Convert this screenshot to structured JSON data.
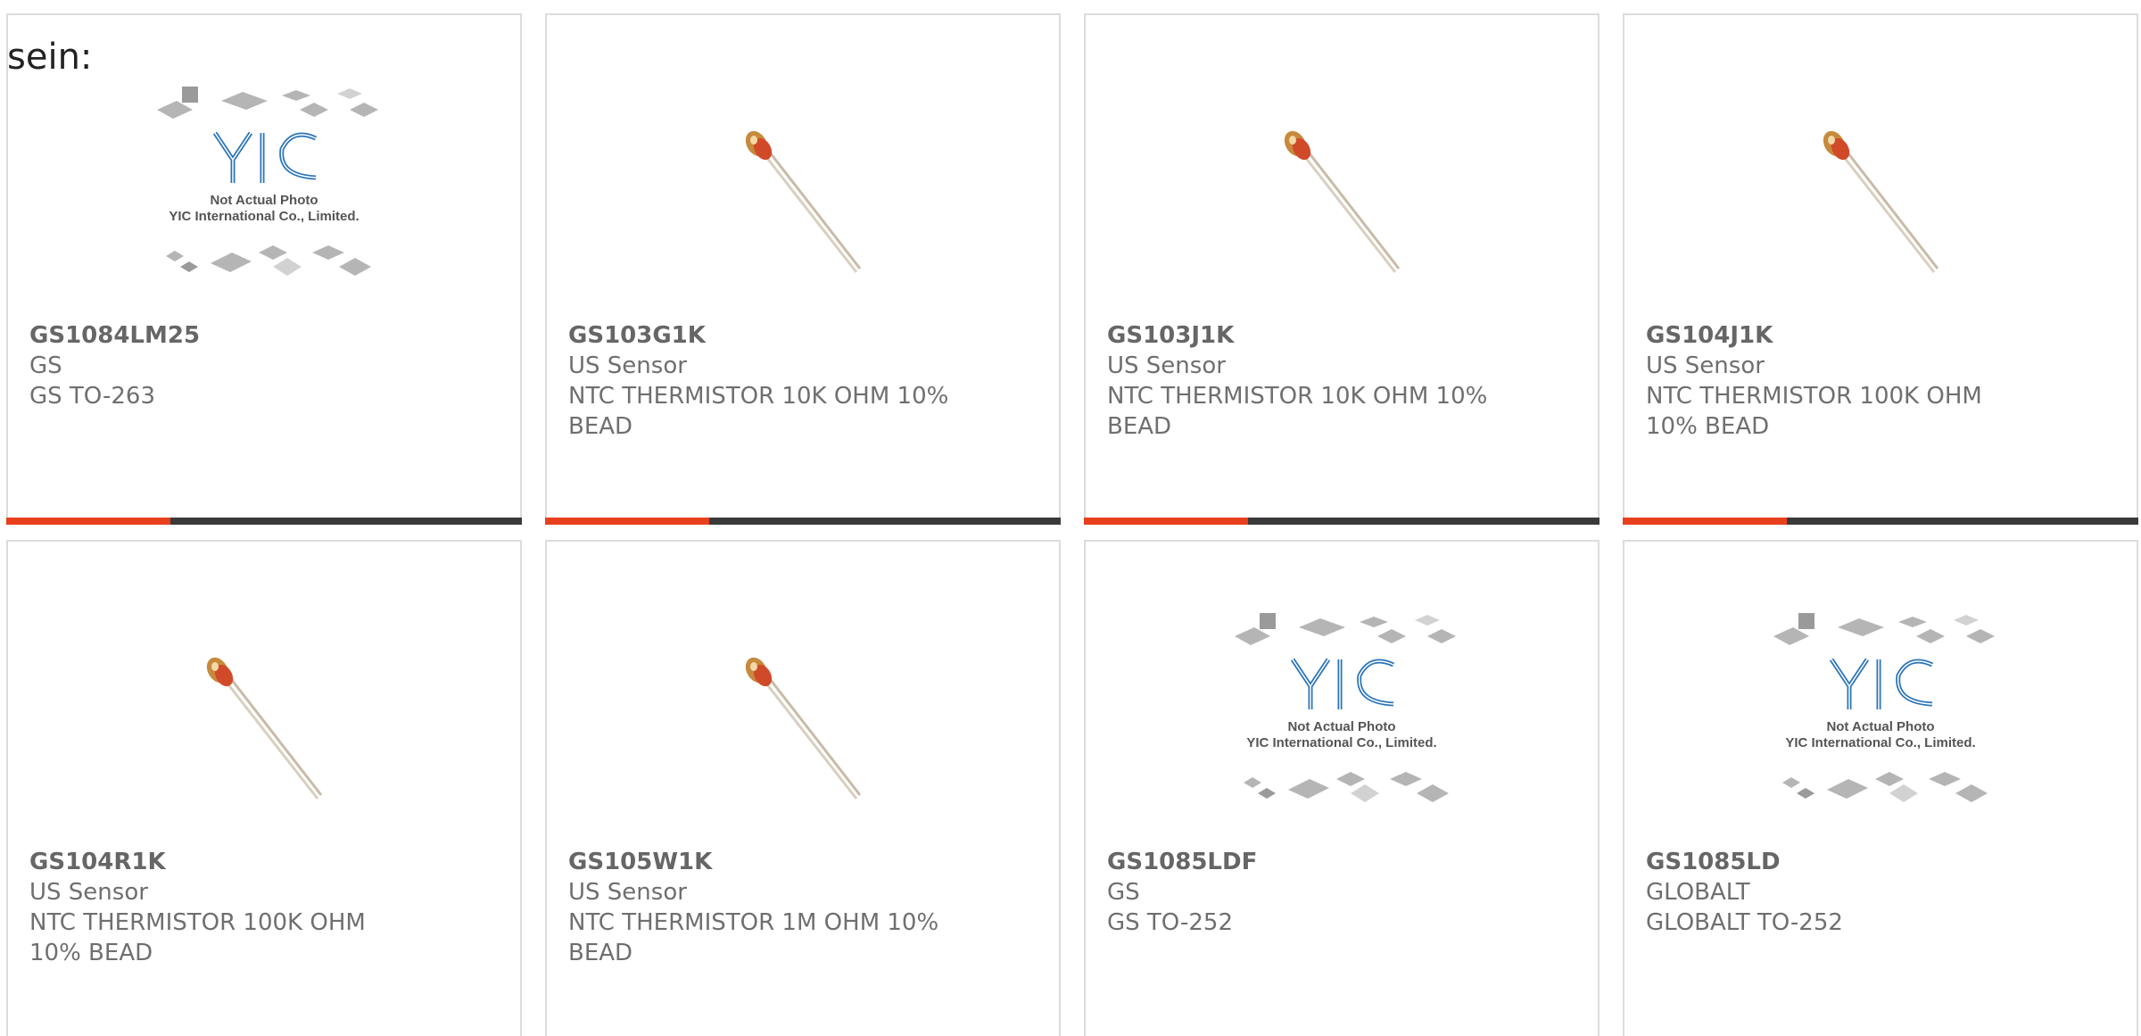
{
  "intro_text": "sein:",
  "placeholder_caption_line1": "Not Actual Photo",
  "placeholder_caption_line2": "YIC International Co., Limited.",
  "brand_logo_text": "YIC",
  "colors": {
    "accent": "#e8401c",
    "bar": "#3a3a3a",
    "border": "#dcdcdc",
    "text": "#6f6f6f"
  },
  "products": [
    {
      "part_number": "GS1084LM25",
      "manufacturer": "GS",
      "description": "GS TO-263",
      "image": "placeholder-yic-icon",
      "show_bar": true
    },
    {
      "part_number": "GS103G1K",
      "manufacturer": "US Sensor",
      "description": "NTC THERMISTOR 10K OHM 10% BEAD",
      "image": "thermistor-icon",
      "show_bar": true
    },
    {
      "part_number": "GS103J1K",
      "manufacturer": "US Sensor",
      "description": "NTC THERMISTOR 10K OHM 10% BEAD",
      "image": "thermistor-icon",
      "show_bar": true
    },
    {
      "part_number": "GS104J1K",
      "manufacturer": "US Sensor",
      "description": "NTC THERMISTOR 100K OHM 10% BEAD",
      "image": "thermistor-icon",
      "show_bar": true
    },
    {
      "part_number": "GS104R1K",
      "manufacturer": "US Sensor",
      "description": "NTC THERMISTOR 100K OHM 10% BEAD",
      "image": "thermistor-icon",
      "show_bar": false
    },
    {
      "part_number": "GS105W1K",
      "manufacturer": "US Sensor",
      "description": "NTC THERMISTOR 1M OHM 10% BEAD",
      "image": "thermistor-icon",
      "show_bar": false
    },
    {
      "part_number": "GS1085LDF",
      "manufacturer": "GS",
      "description": "GS TO-252",
      "image": "placeholder-yic-icon",
      "show_bar": false
    },
    {
      "part_number": "GS1085LD",
      "manufacturer": "GLOBALT",
      "description": "GLOBALT TO-252",
      "image": "placeholder-yic-icon",
      "show_bar": false
    }
  ]
}
